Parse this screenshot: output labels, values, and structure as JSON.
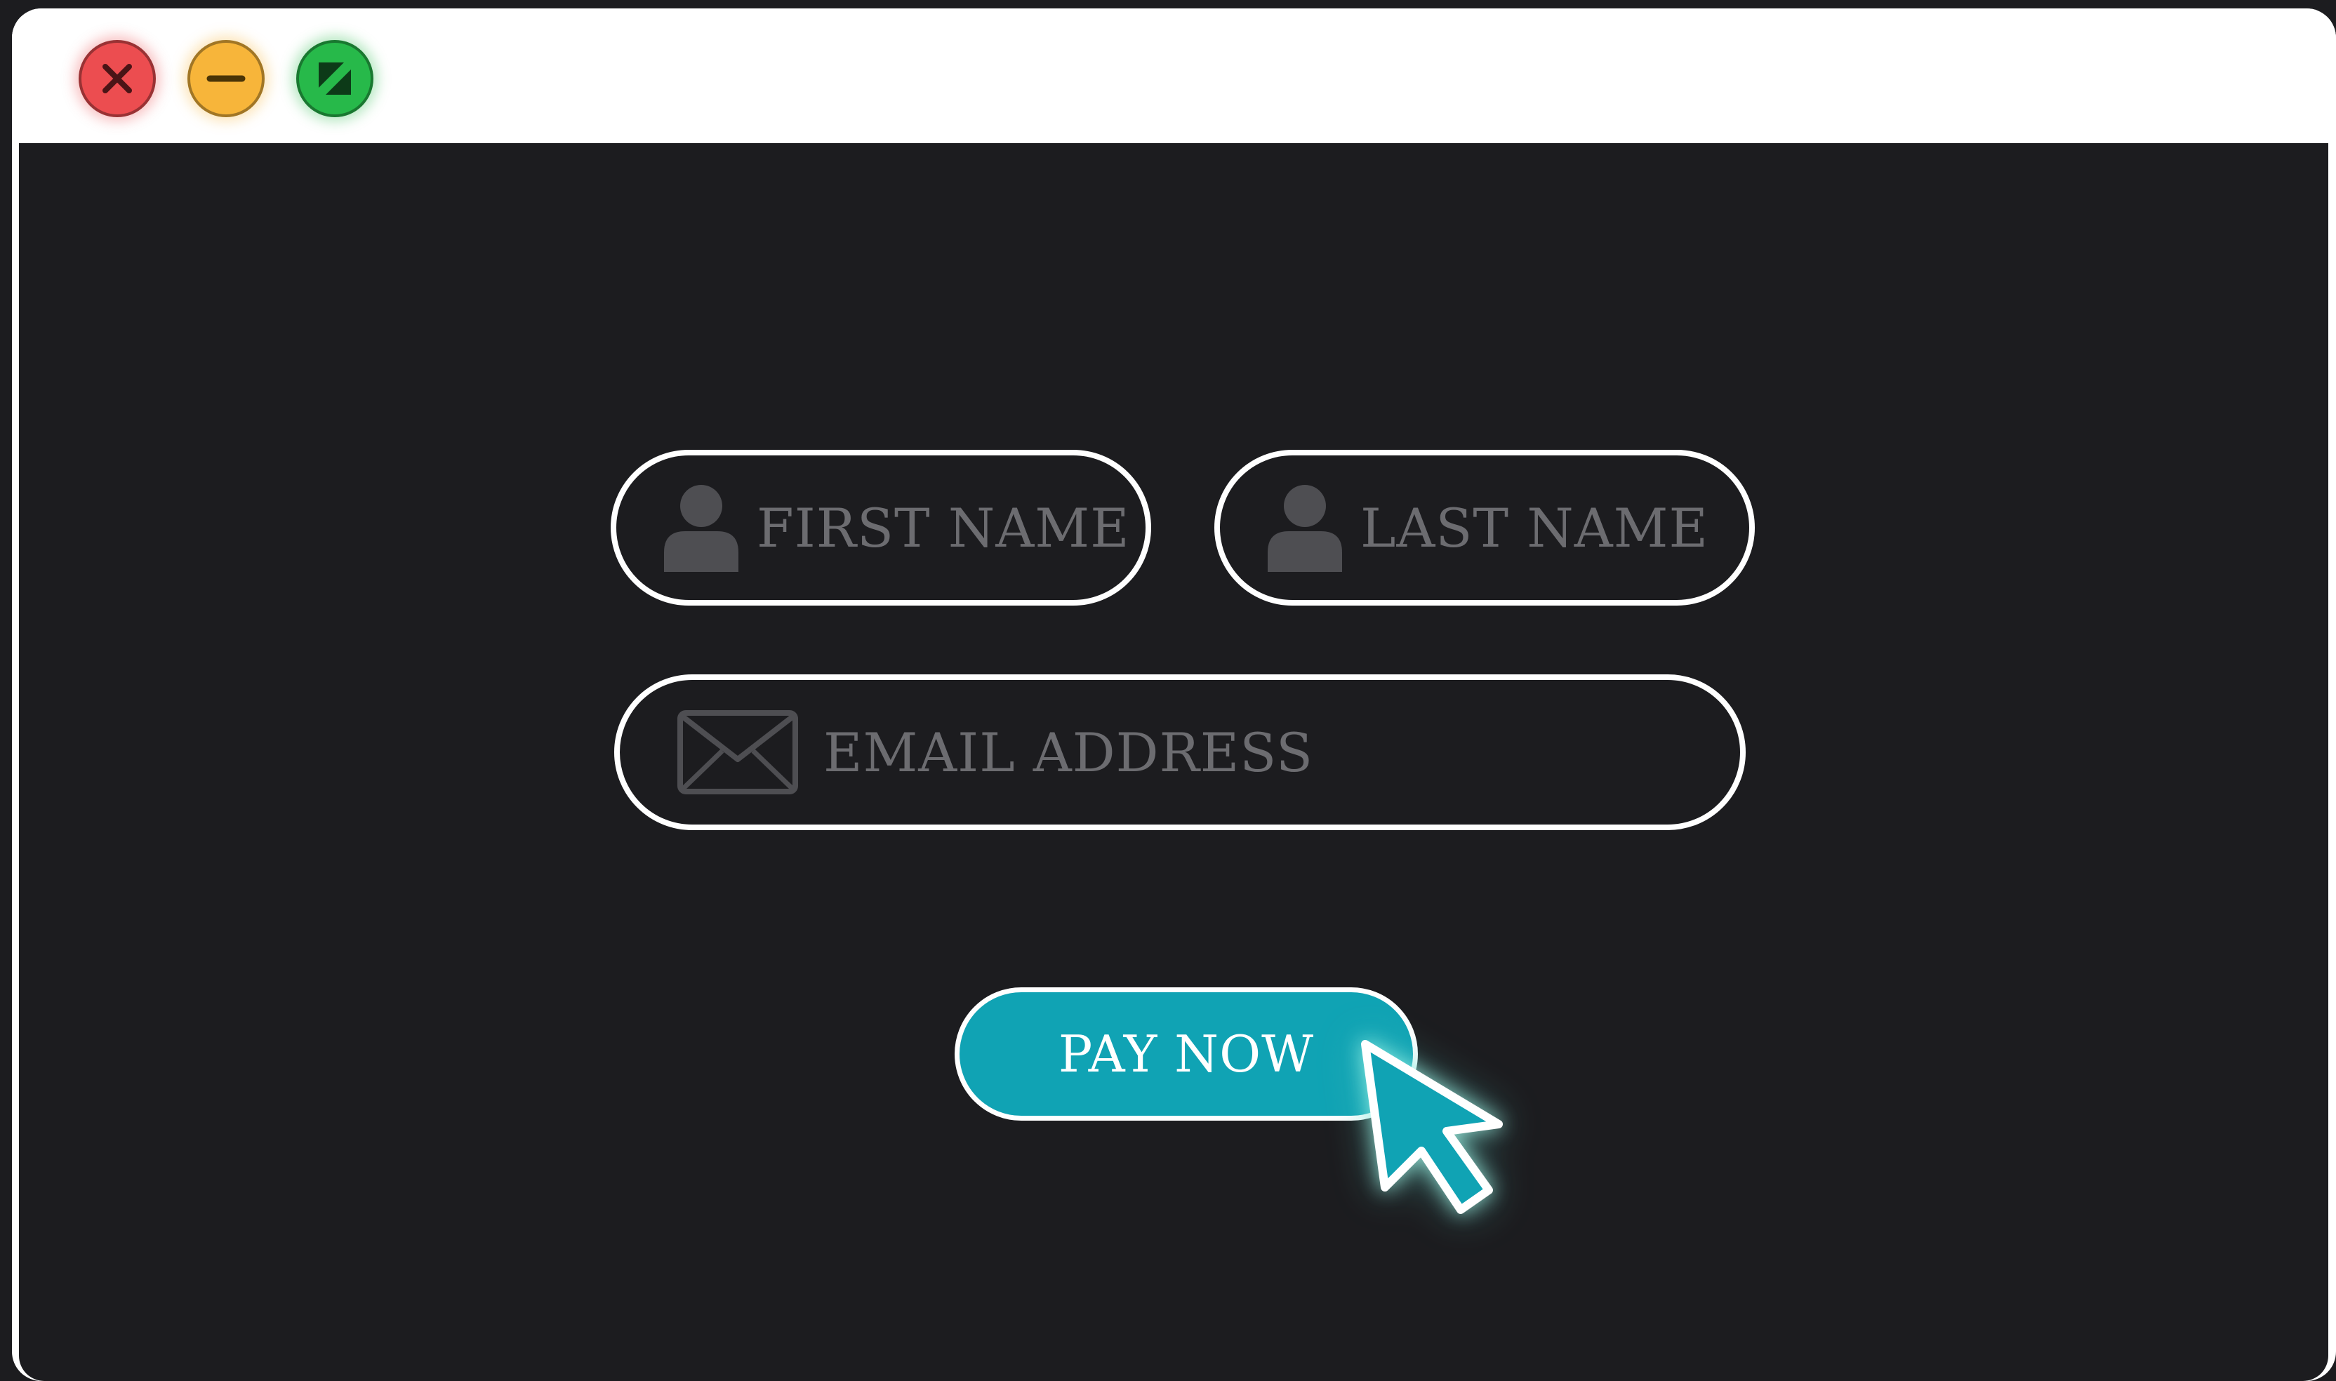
{
  "window": {
    "controls": {
      "close": {
        "icon": "close-x-icon",
        "color": "#ec4d50"
      },
      "minimize": {
        "icon": "minus-icon",
        "color": "#f7b53a"
      },
      "maximize": {
        "icon": "expand-arrow-icon",
        "color": "#27b94a"
      }
    }
  },
  "form": {
    "first_name": {
      "placeholder": "FIRST NAME",
      "icon": "user-icon"
    },
    "last_name": {
      "placeholder": "LAST NAME",
      "icon": "user-icon"
    },
    "email": {
      "placeholder": "EMAIL ADDRESS",
      "icon": "envelope-icon"
    },
    "submit": {
      "label": "PAY NOW",
      "color": "#10a3b4"
    }
  },
  "cursor": {
    "icon": "pointer-cursor-icon",
    "color": "#10a3b4"
  },
  "colors": {
    "background": "#1c1c1f",
    "field_border": "#ffffff",
    "placeholder": "#6c6c70"
  }
}
